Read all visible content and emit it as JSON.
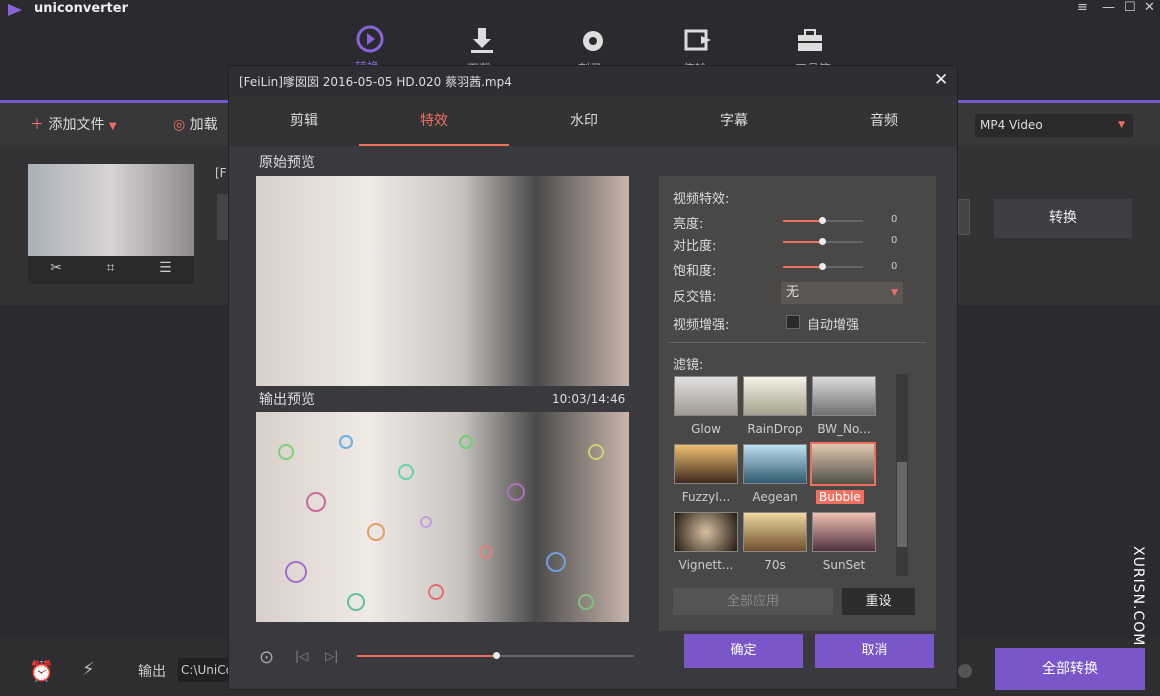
{
  "app": {
    "title": "uniconverter"
  },
  "nav": {
    "items": [
      {
        "label": "转换",
        "icon": "convert-icon"
      },
      {
        "label": "下载",
        "icon": "download-icon"
      },
      {
        "label": "刻录",
        "icon": "burn-icon"
      },
      {
        "label": "传输",
        "icon": "transfer-icon"
      },
      {
        "label": "工具箱",
        "icon": "toolbox-icon"
      }
    ]
  },
  "toolbar": {
    "add_files": "添加文件",
    "load": "加载",
    "format": "MP4 Video"
  },
  "file": {
    "name_prefix": "[F",
    "convert_btn": "转换"
  },
  "dialog": {
    "title": "[FeiLin]嗲囡囡 2016-05-05 HD.020 蔡羽茜.mp4",
    "tabs": [
      "剪辑",
      "特效",
      "水印",
      "字幕",
      "音频"
    ],
    "active_tab": "特效",
    "original_preview": "原始预览",
    "output_preview": "输出预览",
    "time": "10:03/14:46",
    "effects": {
      "header": "视频特效:",
      "brightness": "亮度:",
      "brightness_val": "0",
      "contrast": "对比度:",
      "contrast_val": "0",
      "saturation": "饱和度:",
      "saturation_val": "0",
      "deinterlace": "反交错:",
      "deinterlace_val": "无",
      "enhance": "视频增强:",
      "auto_enhance": "自动增强"
    },
    "filters": {
      "header": "滤镜:",
      "items": [
        "Glow",
        "RainDrop",
        "BW_No...",
        "FuzzyI...",
        "Aegean",
        "Bubble",
        "Vignett...",
        "70s",
        "SunSet"
      ],
      "selected": "Bubble"
    },
    "apply_all": "全部应用",
    "reset": "重设",
    "ok": "确定",
    "cancel": "取消",
    "progress": 0.5
  },
  "bottom": {
    "output_label": "输出",
    "output_path": "C:\\UniCo",
    "convert_all": "全部转换"
  },
  "watermark": {
    "text": "XURISN.COM"
  },
  "colors": {
    "accent": "#7a57c9",
    "highlight": "#f07060"
  }
}
